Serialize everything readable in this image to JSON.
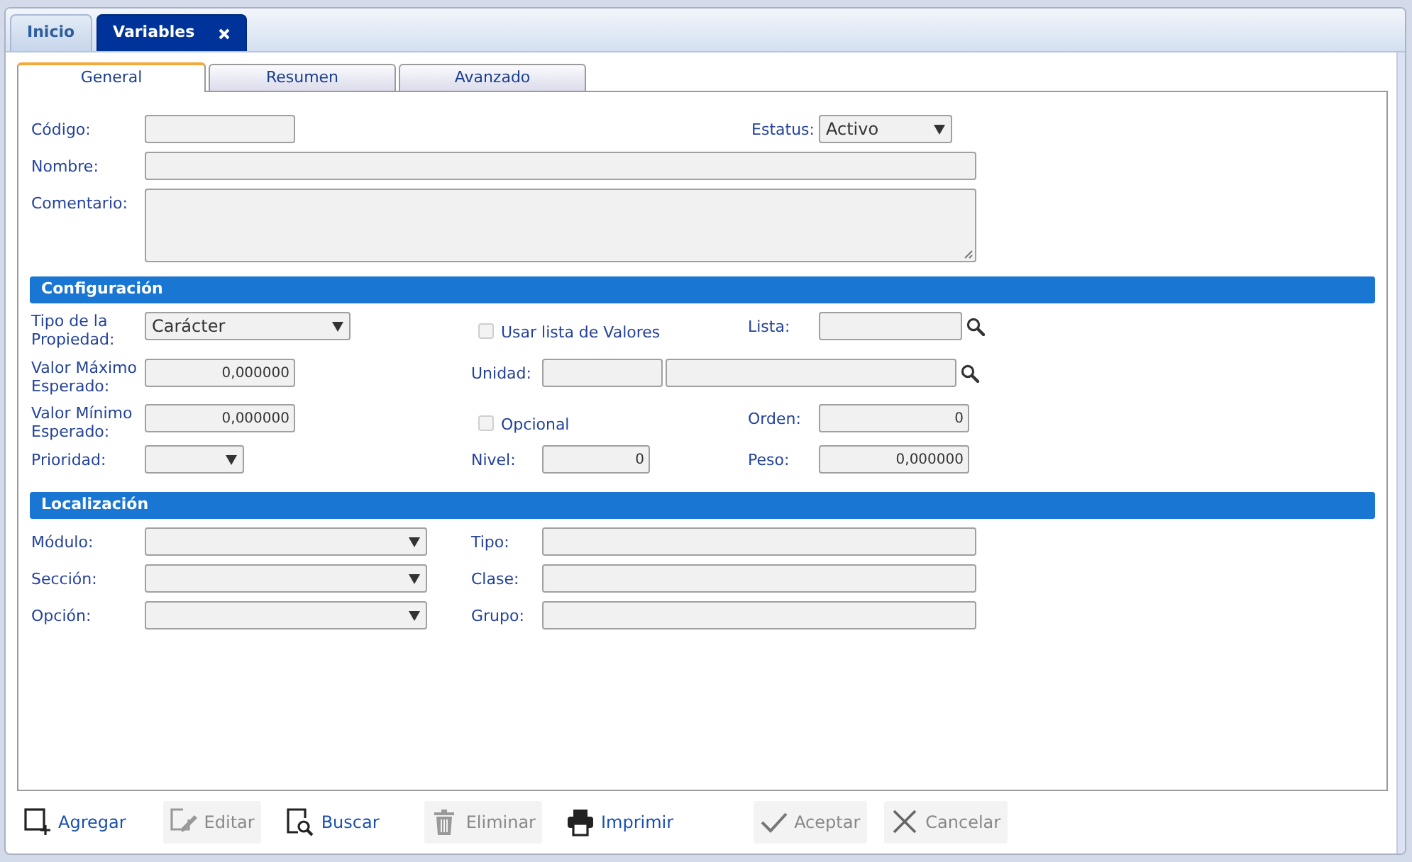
{
  "tabs": [
    {
      "label": "Inicio",
      "selected": false,
      "closable": false
    },
    {
      "label": "Variables",
      "selected": true,
      "closable": true
    }
  ],
  "subtabs": [
    {
      "label": "General",
      "selected": true
    },
    {
      "label": "Resumen",
      "selected": false
    },
    {
      "label": "Avanzado",
      "selected": false
    }
  ],
  "sections": [
    {
      "rows": [
        [
          {
            "kind": "text",
            "label": "Código:"
          },
          {
            "kind": "select",
            "label": "Estatus:",
            "value": "Activo"
          }
        ],
        [
          {
            "kind": "text",
            "label": "Nombre:"
          }
        ],
        [
          {
            "kind": "textarea",
            "label": "Comentario:"
          }
        ]
      ]
    },
    {
      "title": "Configuración",
      "rows": [
        [
          {
            "kind": "select",
            "label": "Tipo de la Propiedad:",
            "value": "Carácter"
          },
          {
            "kind": "checkbox",
            "label": "Usar lista de Valores",
            "checked": false,
            "disabled": true
          },
          {
            "kind": "lookup",
            "label": "Lista:"
          }
        ],
        [
          {
            "kind": "number",
            "label": "Valor Máximo Esperado:",
            "value": "0,000000"
          },
          {
            "kind": "lookup2",
            "label": "Unidad:"
          }
        ],
        [
          {
            "kind": "number",
            "label": "Valor Mínimo Esperado:",
            "value": "0,000000"
          },
          {
            "kind": "checkbox",
            "label": "Opcional",
            "checked": false,
            "disabled": true
          },
          {
            "kind": "number",
            "label": "Orden:",
            "value": "0"
          }
        ],
        [
          {
            "kind": "select",
            "label": "Prioridad:"
          },
          {
            "kind": "number",
            "label": "Nivel:",
            "value": "0"
          },
          {
            "kind": "number",
            "label": "Peso:",
            "value": "0,000000"
          }
        ]
      ]
    },
    {
      "title": "Localización",
      "rows": [
        [
          {
            "kind": "select",
            "label": "Módulo:"
          },
          {
            "kind": "text",
            "label": "Tipo:"
          }
        ],
        [
          {
            "kind": "select",
            "label": "Sección:"
          },
          {
            "kind": "text",
            "label": "Clase:"
          }
        ],
        [
          {
            "kind": "select",
            "label": "Opción:"
          },
          {
            "kind": "text",
            "label": "Grupo:"
          }
        ]
      ]
    }
  ],
  "toolbar": [
    {
      "kind": "add",
      "label": "Agregar",
      "disabled": false
    },
    {
      "kind": "edit",
      "label": "Editar",
      "disabled": true
    },
    {
      "kind": "search",
      "label": "Buscar",
      "disabled": false
    },
    {
      "kind": "delete",
      "label": "Eliminar",
      "disabled": true
    },
    {
      "kind": "print",
      "label": "Imprimir",
      "disabled": false
    },
    {
      "kind": "accept",
      "label": "Aceptar",
      "disabled": true
    },
    {
      "kind": "cancel",
      "label": "Cancelar",
      "disabled": true
    }
  ]
}
